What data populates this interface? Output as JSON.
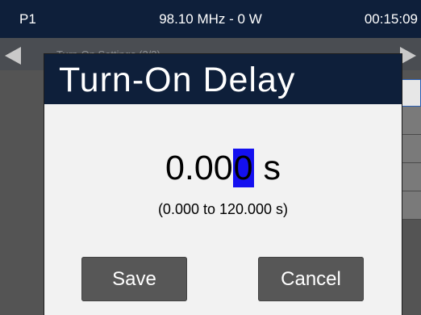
{
  "status_bar": {
    "preset": "P1",
    "frequency_power": "98.10 MHz - 0 W",
    "clock": "00:15:09"
  },
  "background": {
    "nav_text": "Turn-On Settings (2/3)"
  },
  "dialog": {
    "title": "Turn-On Delay",
    "value_prefix": "0.00",
    "value_cursor_digit": "0",
    "value_unit": "s",
    "range": "(0.000 to 120.000 s)",
    "save_label": "Save",
    "cancel_label": "Cancel"
  },
  "colors": {
    "header_bg": "#0e1f3a",
    "cursor_highlight": "#1410f0",
    "button_bg": "#575757",
    "dialog_bg": "#f2f2f2"
  }
}
